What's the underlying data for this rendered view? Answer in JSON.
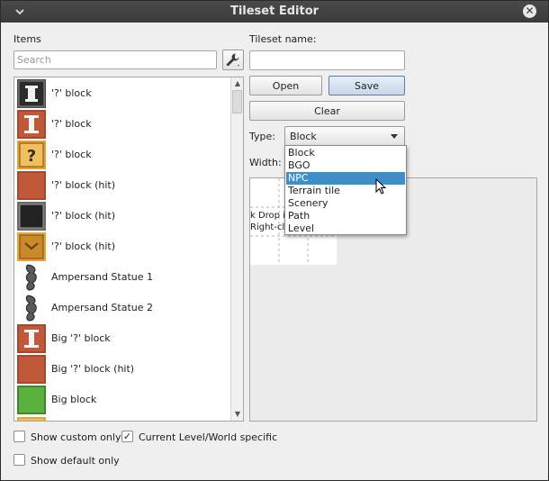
{
  "window": {
    "title": "Tileset Editor"
  },
  "items_panel": {
    "label": "Items",
    "search_placeholder": "Search",
    "items": [
      {
        "name": "'?' block",
        "icon": "question-block-gray-icon"
      },
      {
        "name": "'?' block",
        "icon": "question-block-brown-icon"
      },
      {
        "name": "'?' block",
        "icon": "question-block-yellow-icon"
      },
      {
        "name": "'?' block (hit)",
        "icon": "used-block-brown-icon"
      },
      {
        "name": "'?' block (hit)",
        "icon": "used-block-gray-icon"
      },
      {
        "name": "'?' block (hit)",
        "icon": "used-block-yellow-icon"
      },
      {
        "name": "Ampersand Statue 1",
        "icon": "ampersand-statue-icon"
      },
      {
        "name": "Ampersand Statue 2",
        "icon": "ampersand-statue-icon"
      },
      {
        "name": "Big '?' block",
        "icon": "big-question-block-icon"
      },
      {
        "name": "Big '?' block (hit)",
        "icon": "big-used-block-icon"
      },
      {
        "name": "Big block",
        "icon": "big-green-block-icon"
      }
    ]
  },
  "tileset": {
    "name_label": "Tileset name:",
    "name_value": "",
    "open_label": "Open",
    "save_label": "Save",
    "clear_label": "Clear",
    "type_label": "Type:",
    "type_value": "Block",
    "width_label": "Width:",
    "type_options": [
      "Block",
      "BGO",
      "NPC",
      "Terrain tile",
      "Scenery",
      "Path",
      "Level"
    ],
    "highlighted_option": "NPC",
    "preview_hint_line1": "k Drop it",
    "preview_hint_line2": "Right-clic"
  },
  "options": {
    "show_custom_only": {
      "label": "Show custom only",
      "checked": false
    },
    "current_level_world_specific": {
      "label": "Current Level/World specific",
      "checked": true
    },
    "show_default_only": {
      "label": "Show default only",
      "checked": false
    }
  },
  "colors": {
    "selection": "#3d8ec9",
    "title_bar": "#3a3a3a",
    "block_brown": "#c0583a",
    "block_gray": "#5a5a5a",
    "block_yellow": "#e8a23a",
    "block_green": "#5bb040"
  }
}
